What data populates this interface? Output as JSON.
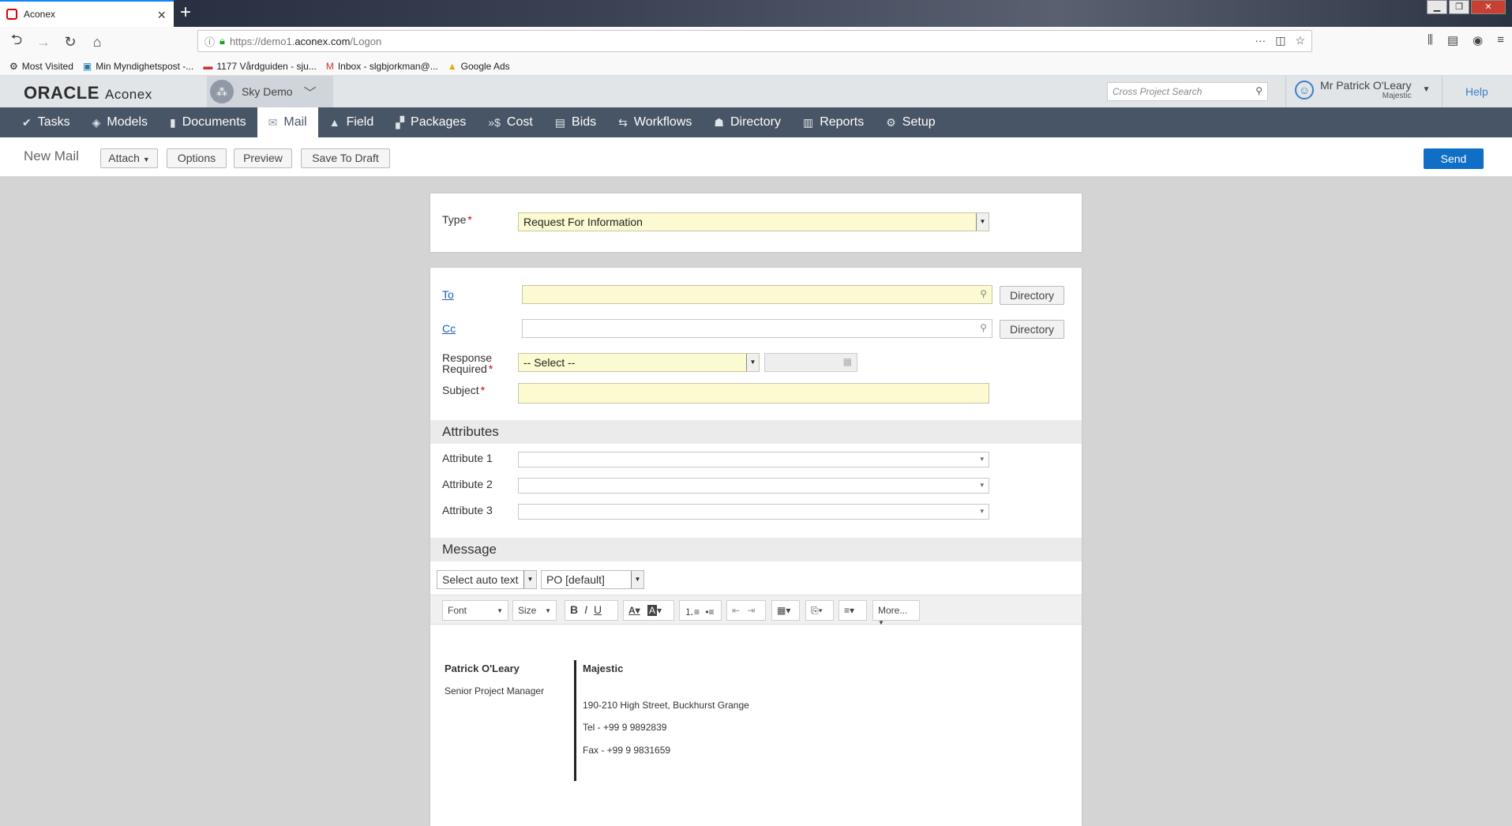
{
  "browser": {
    "tab_title": "Aconex",
    "url_prefix": "https://demo1.",
    "url_domain": "aconex.com",
    "url_path": "/Logon",
    "bookmarks": [
      {
        "label": "Most Visited",
        "icon": "gear-icon"
      },
      {
        "label": "Min Myndighetspost -...",
        "icon": "flag-icon"
      },
      {
        "label": "1177 Vårdguiden - sju...",
        "icon": "health-icon"
      },
      {
        "label": "Inbox - slgbjorkman@...",
        "icon": "gmail-icon"
      },
      {
        "label": "Google Ads",
        "icon": "ads-icon"
      }
    ]
  },
  "header": {
    "brand": "ORACLE",
    "product": "Aconex",
    "project": "Sky Demo",
    "search_placeholder": "Cross Project Search",
    "user_name": "Mr Patrick O'Leary",
    "user_company": "Majestic",
    "help": "Help"
  },
  "modules": [
    {
      "label": "Tasks",
      "icon": "check-icon",
      "glyph": "✔"
    },
    {
      "label": "Models",
      "icon": "cube-icon",
      "glyph": "◈"
    },
    {
      "label": "Documents",
      "icon": "document-icon",
      "glyph": "▮"
    },
    {
      "label": "Mail",
      "icon": "mail-icon",
      "glyph": "✉",
      "active": true
    },
    {
      "label": "Field",
      "icon": "field-icon",
      "glyph": "▲"
    },
    {
      "label": "Packages",
      "icon": "packages-icon",
      "glyph": "▞"
    },
    {
      "label": "Cost",
      "icon": "cost-icon",
      "glyph": "»$"
    },
    {
      "label": "Bids",
      "icon": "bids-icon",
      "glyph": "▤"
    },
    {
      "label": "Workflows",
      "icon": "workflow-icon",
      "glyph": "⇆"
    },
    {
      "label": "Directory",
      "icon": "people-icon",
      "glyph": "☗"
    },
    {
      "label": "Reports",
      "icon": "chart-icon",
      "glyph": "▥"
    },
    {
      "label": "Setup",
      "icon": "gear-icon",
      "glyph": "⚙"
    }
  ],
  "toolbar": {
    "title": "New Mail",
    "attach": "Attach",
    "options": "Options",
    "preview": "Preview",
    "save_draft": "Save To Draft",
    "send": "Send"
  },
  "form": {
    "type_label": "Type",
    "type_value": "Request For Information",
    "to_label": "To",
    "cc_label": "Cc",
    "directory": "Directory",
    "response_label_1": "Response",
    "response_label_2": "Required",
    "response_value": "-- Select --",
    "subject_label": "Subject",
    "attributes_heading": "Attributes",
    "attribute_1": "Attribute 1",
    "attribute_2": "Attribute 2",
    "attribute_3": "Attribute 3",
    "message_heading": "Message",
    "auto_text": "Select auto text",
    "po_value": "PO [default]"
  },
  "editor": {
    "font": "Font",
    "size": "Size",
    "more": "More..."
  },
  "signature": {
    "name": "Patrick O'Leary",
    "role": "Senior Project Manager",
    "company": "Majestic",
    "address": "190-210 High Street, Buckhurst Grange",
    "tel": "Tel - +99 9 9892839",
    "fax": "Fax - +99 9 9831659"
  }
}
